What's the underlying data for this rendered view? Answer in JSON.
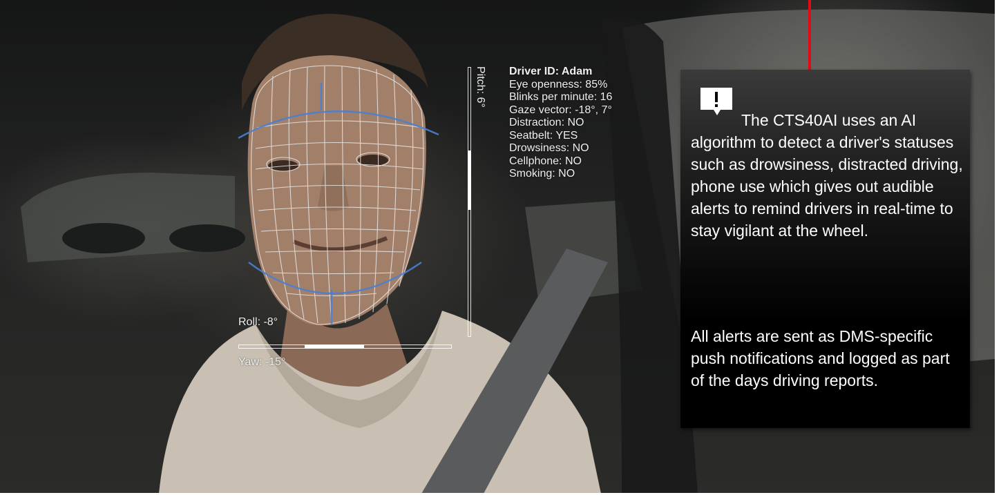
{
  "hud": {
    "driver_id": "Driver ID: Adam",
    "stats": [
      "Eye openness: 85%",
      "Blinks per minute: 16",
      "Gaze vector: -18°, 7°",
      "Distraction: NO",
      "Seatbelt: YES",
      "Drowsiness: NO",
      "Cellphone: NO",
      "Smoking: NO"
    ],
    "pitch_label": "Pitch: 6°",
    "roll_label": "Roll: -8°",
    "yaw_label": "Yaw: -15°",
    "pitch_indicator": {
      "start_fraction": 0.31,
      "length_fraction": 0.22
    },
    "yaw_indicator": {
      "start_fraction": 0.31,
      "length_fraction": 0.28
    }
  },
  "card": {
    "icon": "speech-alert-icon",
    "paragraph_1": "The CTS40AI uses an AI algorithm to detect a driver's statuses such as drowsiness, distracted driving, phone use which gives out audible alerts to remind drivers in real-time to stay vigilant at the wheel.",
    "paragraph_2": "All alerts are sent as DMS-specific push notifications and logged as part of the days driving reports."
  },
  "colors": {
    "accent_red": "#e10a17",
    "mesh_blue": "#4a7fd0",
    "card_bg": "#000000"
  }
}
